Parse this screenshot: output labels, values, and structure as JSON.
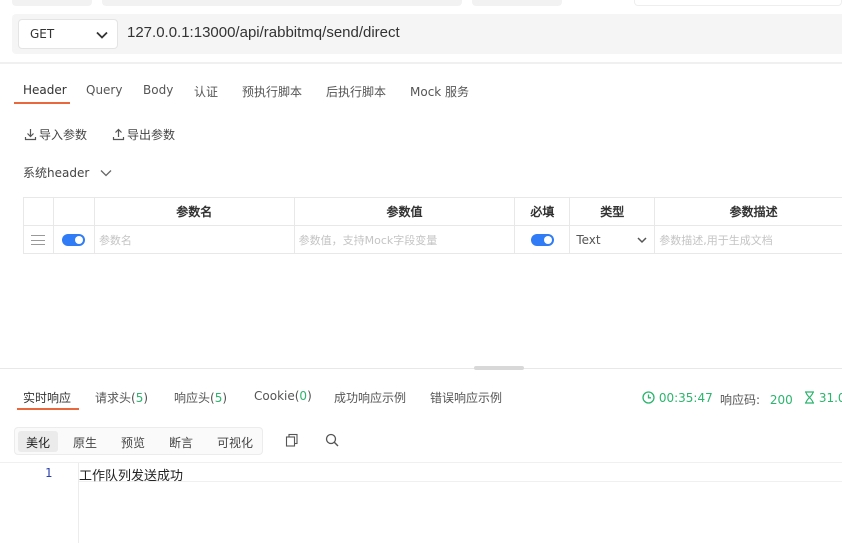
{
  "request": {
    "method": "GET",
    "url": "127.0.0.1:13000/api/rabbitmq/send/direct"
  },
  "tabs": [
    "Header",
    "Query",
    "Body",
    "认证",
    "预执行脚本",
    "后执行脚本",
    "Mock 服务"
  ],
  "actions": {
    "import": "导入参数",
    "export": "导出参数",
    "system_header": "系统header"
  },
  "table": {
    "headers": [
      "参数名",
      "参数值",
      "必填",
      "类型",
      "参数描述"
    ],
    "row": {
      "name_placeholder": "参数名",
      "value_placeholder": "参数值，支持Mock字段变量",
      "type": "Text",
      "desc_placeholder": "参数描述,用于生成文档"
    }
  },
  "response_tabs": {
    "realtime": "实时响应",
    "req_headers": "请求头(",
    "req_headers_count": "5",
    "resp_headers": "响应头(",
    "resp_headers_count": "5",
    "cookie": "Cookie(",
    "cookie_count": "0",
    "close_paren": ")",
    "success_example": "成功响应示例",
    "error_example": "错误响应示例"
  },
  "stats": {
    "time": "00:35:47",
    "status_label": "响应码:",
    "status_code": "200",
    "duration": "31.0"
  },
  "view_modes": [
    "美化",
    "原生",
    "预览",
    "断言",
    "可视化"
  ],
  "code": {
    "line_number": "1",
    "text": "工作队列发送成功"
  },
  "colors": {
    "accent": "#e8673c",
    "toggle": "#2f7cf6",
    "success": "#2bb56d"
  }
}
